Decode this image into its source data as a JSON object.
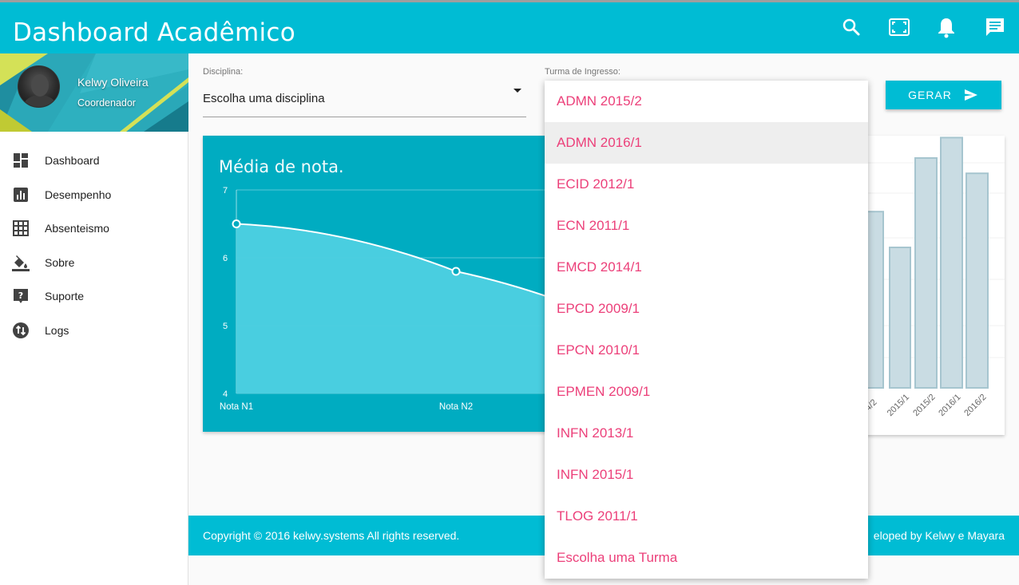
{
  "header": {
    "title": "Dashboard Acadêmico",
    "icons": [
      "search-icon",
      "fullscreen-icon",
      "bell-icon",
      "chat-icon"
    ]
  },
  "profile": {
    "name": "Kelwy Oliveira",
    "role": "Coordenador"
  },
  "sidebar": {
    "items": [
      {
        "label": "Dashboard",
        "icon": "dashboard-icon"
      },
      {
        "label": "Desempenho",
        "icon": "bar-chart-icon"
      },
      {
        "label": "Absenteismo",
        "icon": "grid-icon"
      },
      {
        "label": "Sobre",
        "icon": "paint-bucket-icon"
      },
      {
        "label": "Suporte",
        "icon": "help-icon"
      },
      {
        "label": "Logs",
        "icon": "swap-icon"
      }
    ]
  },
  "filters": {
    "disciplina_label": "Disciplina:",
    "disciplina_value": "Escolha uma disciplina",
    "turma_label": "Turma de Ingresso:",
    "gerar_label": "GERAR"
  },
  "dropdown": {
    "options": [
      "ADMN 2015/2",
      "ADMN 2016/1",
      "ECID 2012/1",
      "ECN 2011/1",
      "EMCD 2014/1",
      "EPCD 2009/1",
      "EPCN 2010/1",
      "EPMEN 2009/1",
      "INFN 2013/1",
      "INFN 2015/1",
      "TLOG 2011/1",
      "Escolha uma Turma"
    ],
    "highlighted": "ADMN 2016/1"
  },
  "chart_data": [
    {
      "type": "area",
      "title": "Média de nota.",
      "categories": [
        "Nota N1",
        "Nota N2"
      ],
      "values": [
        6.5,
        5.8
      ],
      "ylim": [
        4,
        7
      ],
      "yticks": [
        4,
        5,
        6,
        7
      ],
      "grid": true,
      "colors": {
        "background": "#00acc1",
        "fill": "#4dd0e1",
        "line": "#ffffff"
      }
    },
    {
      "type": "bar",
      "categories_visible": [
        "4/2",
        "2015/1",
        "2015/2",
        "2016/1",
        "2016/2"
      ],
      "values_relative": [
        0.69,
        0.55,
        0.9,
        0.98,
        0.84
      ],
      "colors": {
        "bar": "#c9dce3",
        "border": "#a6c5cf"
      }
    }
  ],
  "footer": {
    "copyright": "Copyright © 2016 kelwy.systems All rights reserved.",
    "developed": "eloped by Kelwy e Mayara"
  }
}
